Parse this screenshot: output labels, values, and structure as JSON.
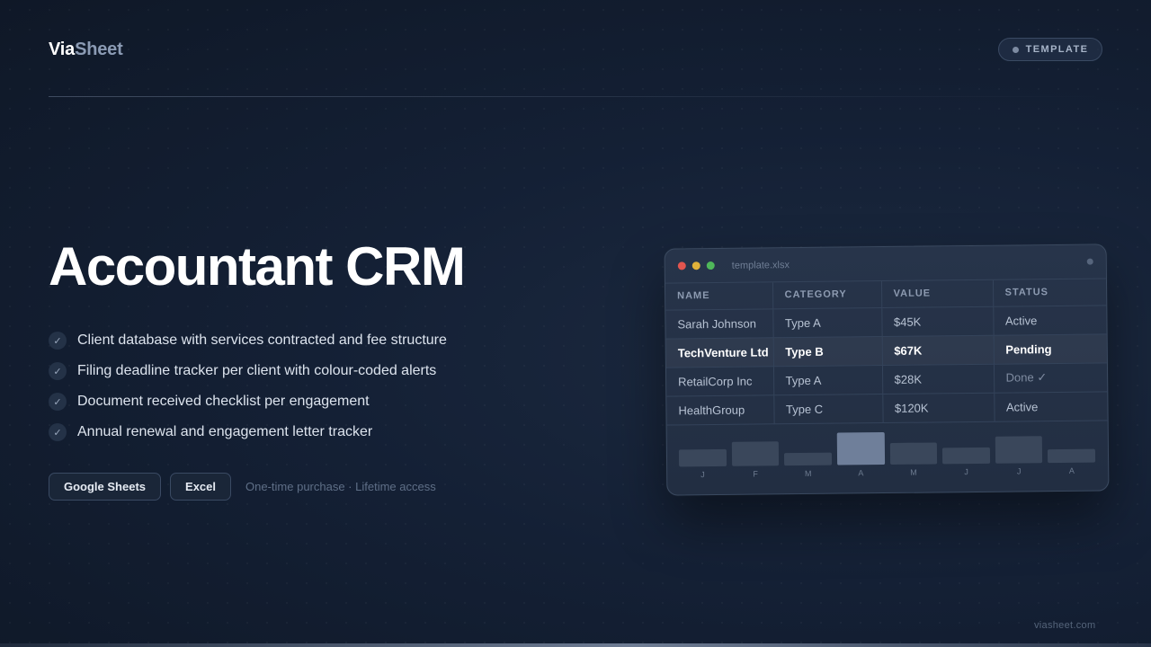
{
  "brand": {
    "part1": "Via",
    "part2": "Sheet"
  },
  "badge": {
    "label": "TEMPLATE"
  },
  "hero": {
    "title": "Accountant CRM"
  },
  "features": [
    "Client database with services contracted and fee structure",
    "Filing deadline tracker per client with colour-coded alerts",
    "Document received checklist per engagement",
    "Annual renewal and engagement letter tracker"
  ],
  "platforms": [
    "Google Sheets",
    "Excel"
  ],
  "purchase_note": "One-time purchase · Lifetime access",
  "preview": {
    "filename": "template.xlsx",
    "columns": [
      "NAME",
      "CATEGORY",
      "VALUE",
      "STATUS"
    ],
    "rows": [
      [
        "Sarah Johnson",
        "Type A",
        "$45K",
        "Active"
      ],
      [
        "TechVenture Ltd",
        "Type B",
        "$67K",
        "Pending"
      ],
      [
        "RetailCorp Inc",
        "Type A",
        "$28K",
        "Done ✓"
      ],
      [
        "HealthGroup",
        "Type C",
        "$120K",
        "Active"
      ]
    ],
    "highlighted_row": 1,
    "chart_months": [
      "J",
      "F",
      "M",
      "A",
      "M",
      "J",
      "J",
      "A"
    ],
    "chart_levels": [
      0.5,
      0.72,
      0.38,
      0.95,
      0.62,
      0.47,
      0.8,
      0.4
    ],
    "chart_peak_index": 3
  },
  "footer": {
    "url": "viasheet.com"
  },
  "icons": {
    "feature_bullet": "check-icon"
  },
  "colors": {
    "background": "#142035",
    "accent_muted": "#8b9bb4"
  }
}
